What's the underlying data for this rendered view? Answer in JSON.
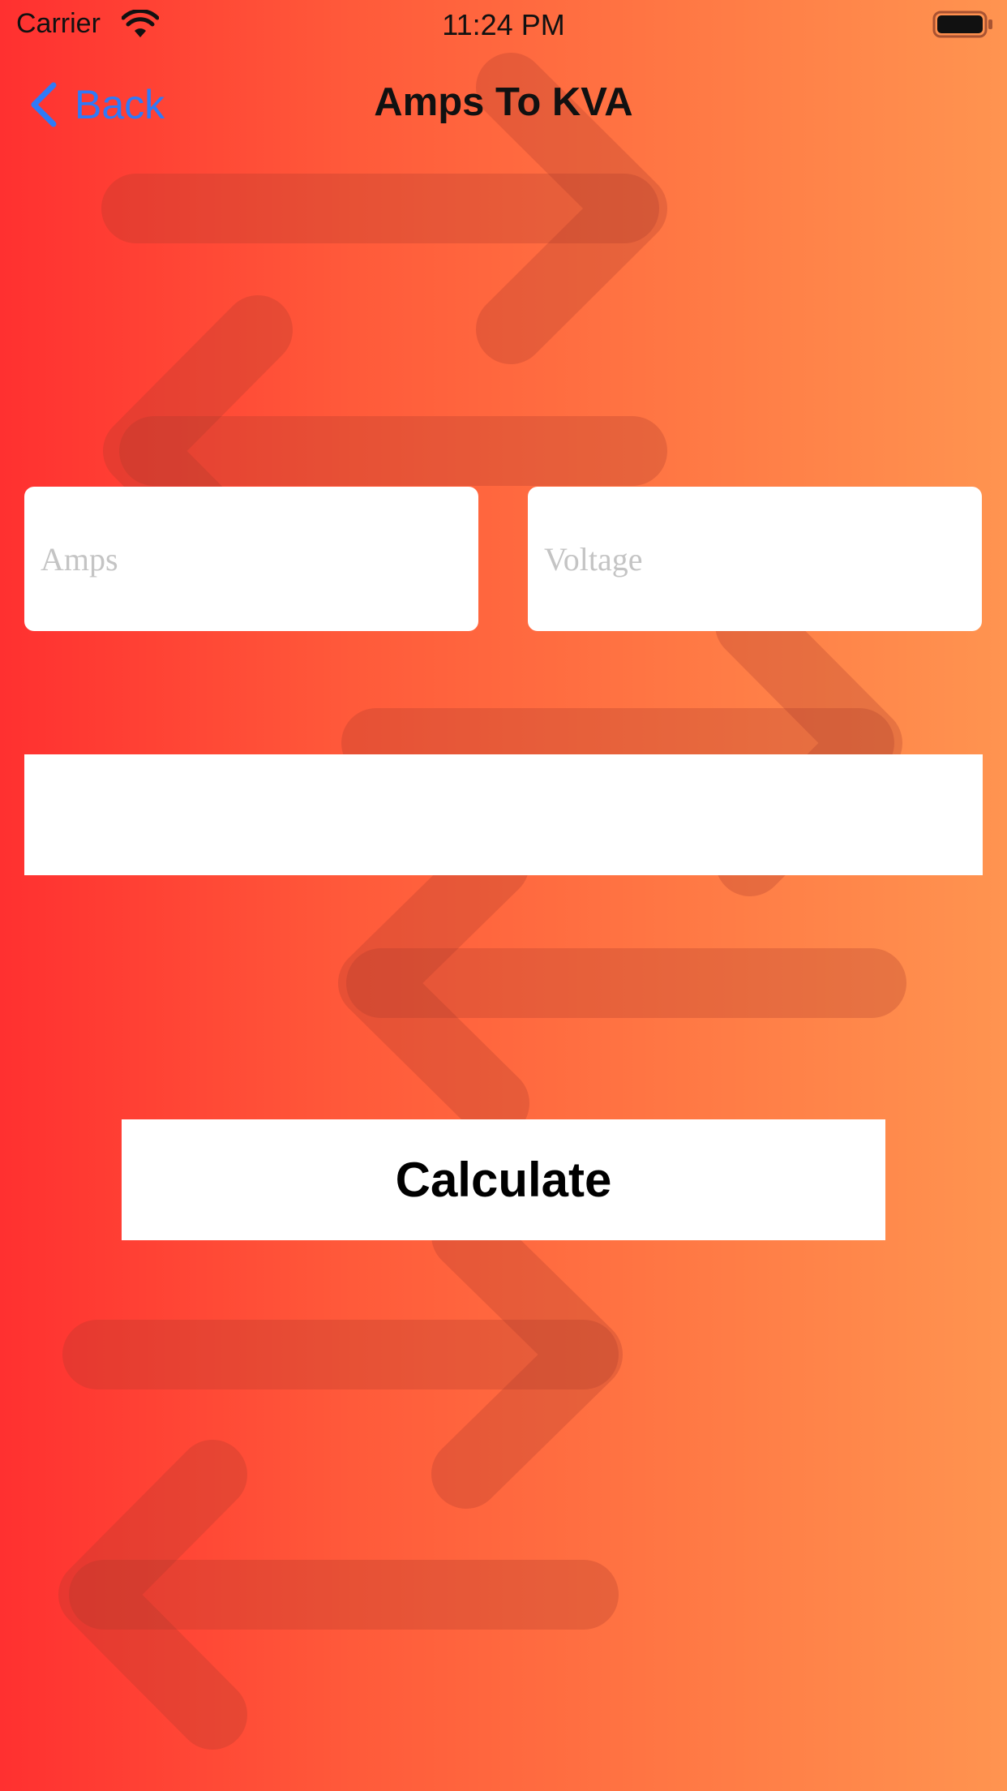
{
  "status_bar": {
    "carrier": "Carrier",
    "time": "11:24 PM",
    "wifi_icon": "wifi-icon",
    "battery_icon": "battery-icon"
  },
  "nav": {
    "back_label": "Back",
    "back_icon": "chevron-left-icon",
    "title": "Amps To KVA",
    "tint_color": "#2f7af7"
  },
  "form": {
    "amps_placeholder": "Amps",
    "amps_value": "",
    "voltage_placeholder": "Voltage",
    "voltage_value": "",
    "result_text": ""
  },
  "actions": {
    "calculate_label": "Calculate"
  },
  "theme": {
    "gradient_start": "#ff3030",
    "gradient_end": "#ff9450",
    "arrow_overlay": "#b03a2a"
  }
}
